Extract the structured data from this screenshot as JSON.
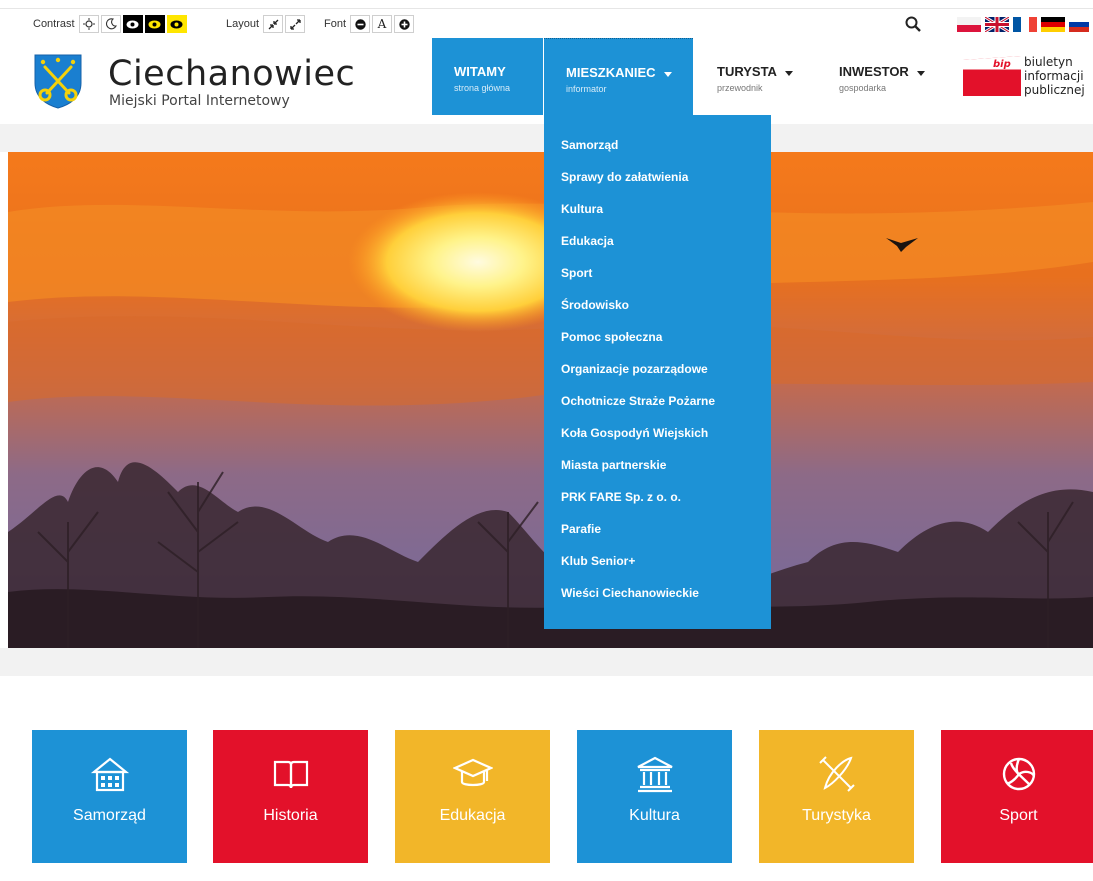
{
  "toolbar": {
    "contrast_label": "Contrast",
    "layout_label": "Layout",
    "font_label": "Font",
    "font_a": "A"
  },
  "header": {
    "title": "Ciechanowiec",
    "subtitle": "Miejski Portal Internetowy"
  },
  "nav": [
    {
      "label": "WITAMY",
      "sub": "strona główna"
    },
    {
      "label": "MIESZKANIEC",
      "sub": "informator"
    },
    {
      "label": "TURYSTA",
      "sub": "przewodnik"
    },
    {
      "label": "INWESTOR",
      "sub": "gospodarka"
    }
  ],
  "bip": {
    "logo_text": "bip",
    "line1": "biuletyn",
    "line2": "informacji",
    "line3": "publicznej"
  },
  "dropdown": [
    "Samorząd",
    "Sprawy do załatwienia",
    "Kultura",
    "Edukacja",
    "Sport",
    "Środowisko",
    "Pomoc społeczna",
    "Organizacje pozarządowe",
    "Ochotnicze Straże Pożarne",
    "Koła Gospodyń Wiejskich",
    "Miasta partnerskie",
    "PRK FARE Sp. z o. o.",
    "Parafie",
    "Klub Senior+",
    "Wieści Ciechanowieckie"
  ],
  "tiles": [
    {
      "label": "Samorząd",
      "icon": "building-icon",
      "color": "#1d92d6"
    },
    {
      "label": "Historia",
      "icon": "book-icon",
      "color": "#e3112a"
    },
    {
      "label": "Edukacja",
      "icon": "graduation-cap-icon",
      "color": "#f2b629"
    },
    {
      "label": "Kultura",
      "icon": "museum-icon",
      "color": "#1d92d6"
    },
    {
      "label": "Turystyka",
      "icon": "kayak-icon",
      "color": "#f2b629"
    },
    {
      "label": "Sport",
      "icon": "volleyball-icon",
      "color": "#e3112a"
    }
  ],
  "colors": {
    "accent_blue": "#1d92d6",
    "accent_red": "#e3112a",
    "accent_yellow": "#f2b629"
  }
}
